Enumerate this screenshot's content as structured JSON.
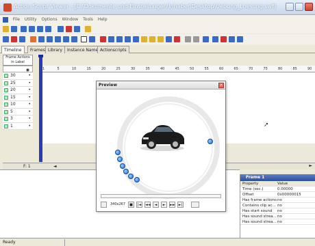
{
  "window": {
    "title": "Action Script Viewer - [C:\\Dokumente und Einstellungen\\Inhaber\\Desktop\\Uebung_Loesung.swf]",
    "accent": "#d24a25"
  },
  "menu": [
    "File",
    "Utility",
    "Options",
    "Window",
    "Tools",
    "Help"
  ],
  "tabs": [
    "Timeline",
    "Frames",
    "Library",
    "Instance Names",
    "Actionscripts"
  ],
  "timeline": {
    "corner_label_top": "Frame Actions",
    "corner_label_bottom": "in Label",
    "ruler_ticks": [
      "1",
      "5",
      "10",
      "15",
      "20",
      "25",
      "30",
      "35",
      "40",
      "45",
      "50",
      "55",
      "60",
      "65",
      "70",
      "75",
      "80",
      "85",
      "90"
    ],
    "layers": [
      {
        "label": "30",
        "marker": "•"
      },
      {
        "label": "25",
        "marker": "•"
      },
      {
        "label": "20",
        "marker": "•"
      },
      {
        "label": "15",
        "marker": "•"
      },
      {
        "label": "10",
        "marker": "•"
      },
      {
        "label": "5",
        "marker": "•"
      },
      {
        "label": "3",
        "marker": "•"
      },
      {
        "label": "1",
        "marker": "•"
      }
    ],
    "position": "F: 1"
  },
  "preview": {
    "title": "Preview",
    "size_label": "340x267",
    "controls": [
      "■",
      "|◄",
      "◄◄",
      "◄",
      "►",
      "►►",
      "►|"
    ]
  },
  "properties": {
    "header": "Frame 1",
    "columns": [
      "Property",
      "Value"
    ],
    "rows": [
      {
        "key": "Time (sec.)",
        "value": "0.00000"
      },
      {
        "key": "Offset",
        "value": "0x00000015"
      },
      {
        "key": "Has frame actions",
        "value": "no"
      },
      {
        "key": "Contains clip ac...",
        "value": "no"
      },
      {
        "key": "Has start sound",
        "value": "no"
      },
      {
        "key": "Has sound strea...",
        "value": "no"
      },
      {
        "key": "Has sound strea...",
        "value": "no"
      }
    ]
  },
  "status": {
    "text": "Ready"
  }
}
